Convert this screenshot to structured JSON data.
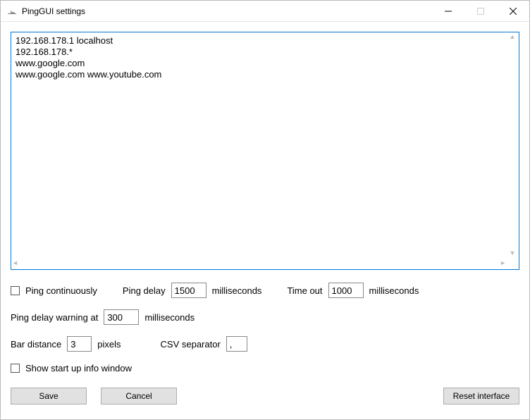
{
  "window": {
    "title": "PingGUI settings"
  },
  "textarea": {
    "content": "192.168.178.1 localhost\n192.168.178.*\nwww.google.com\nwww.google.com www.youtube.com"
  },
  "form": {
    "ping_continuously_label": "Ping continuously",
    "ping_delay_label": "Ping delay",
    "ping_delay_value": "1500",
    "milliseconds_label": "milliseconds",
    "timeout_label": "Time out",
    "timeout_value": "1000",
    "ping_delay_warning_label": "Ping delay warning at",
    "ping_delay_warning_value": "300",
    "bar_distance_label": "Bar distance",
    "bar_distance_value": "3",
    "pixels_label": "pixels",
    "csv_separator_label": "CSV separator",
    "csv_separator_value": ",",
    "show_startup_label": "Show start up info window"
  },
  "buttons": {
    "save": "Save",
    "cancel": "Cancel",
    "reset": "Reset interface"
  }
}
